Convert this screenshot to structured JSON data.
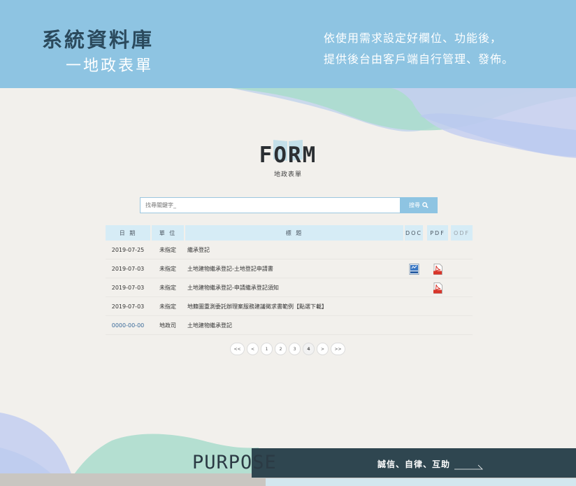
{
  "header": {
    "title": "系統資料庫",
    "subtitle": "一地政表單",
    "desc_line1": "依使用需求設定好欄位、功能後，",
    "desc_line2": "提供後台由客戶端自行管理、發佈。"
  },
  "form_heading": {
    "title": "FORM",
    "subtitle": "地政表單"
  },
  "search": {
    "placeholder": "找尋關鍵字_",
    "button_label": "搜尋",
    "button_icon": "search-icon"
  },
  "table": {
    "columns": [
      "日 期",
      "單 位",
      "標 題",
      "DOC",
      "PDF",
      "ODF"
    ],
    "rows": [
      {
        "date": "2019-07-25",
        "unit": "未指定",
        "title": "繼承登記",
        "doc": false,
        "pdf": false
      },
      {
        "date": "2019-07-03",
        "unit": "未指定",
        "title": "土地建物繼承登記-土地登記申請書",
        "doc": true,
        "pdf": true
      },
      {
        "date": "2019-07-03",
        "unit": "未指定",
        "title": "土地建物繼承登記-申請繼承登記須知",
        "doc": false,
        "pdf": true
      },
      {
        "date": "2019-07-03",
        "unit": "未指定",
        "title": "地籍圖重測委託辦理案服務建議徵求書範例【點選下載】",
        "doc": false,
        "pdf": false
      },
      {
        "date": "0000-00-00",
        "unit": "地政司",
        "title": "土地建物繼承登記",
        "doc": false,
        "pdf": false
      }
    ]
  },
  "pagination": {
    "items": [
      "<<",
      "<",
      "1",
      "2",
      "3",
      "4",
      ">",
      ">>"
    ],
    "current": "4"
  },
  "footer": {
    "word": "PURPOSE",
    "motto": "誠信、自律、互助"
  },
  "colors": {
    "header_bg": "#8ec4e2",
    "title_dark": "#2b4a5d",
    "banner_dark": "#2f4650",
    "mint": "#a9dccd",
    "lavender": "#c5cff1"
  }
}
